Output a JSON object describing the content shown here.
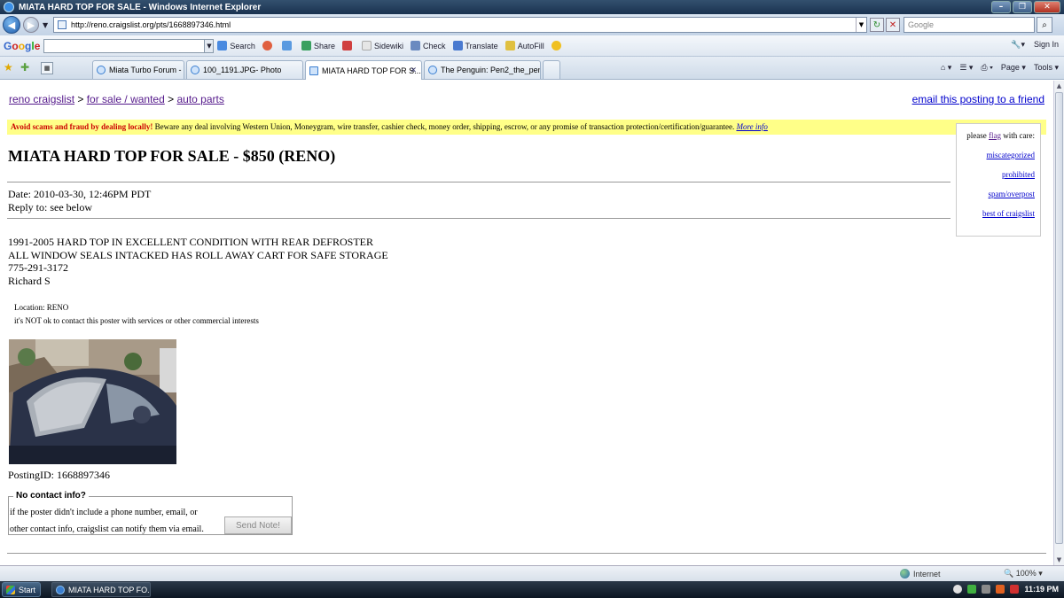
{
  "window": {
    "title": "MIATA HARD TOP FOR SALE - Windows Internet Explorer",
    "minimize": "–",
    "maximize": "❐",
    "close": "✕"
  },
  "address_bar": {
    "url": "http://reno.craigslist.org/pts/1668897346.html",
    "search_placeholder": "Google"
  },
  "google_toolbar": {
    "search_label": "Search",
    "share_label": "Share",
    "sidewiki_label": "Sidewiki",
    "check_label": "Check",
    "translate_label": "Translate",
    "autofill_label": "AutoFill",
    "sign_in_label": "Sign In"
  },
  "tabs": [
    {
      "label": "Miata Turbo Forum - Home ..."
    },
    {
      "label": "100_1191.JPG- Photo"
    },
    {
      "label": "MIATA HARD TOP FOR S..."
    },
    {
      "label": "The Penguin: Pen2_the_pen..."
    }
  ],
  "command_bar": {
    "page_label": "Page",
    "tools_label": "Tools"
  },
  "page": {
    "breadcrumb": {
      "site": "reno craigslist",
      "sep1": " > ",
      "category": "for sale / wanted",
      "sep2": " > ",
      "subcategory": "auto parts"
    },
    "email_friend": "email this posting to a friend",
    "warning": {
      "bold": "Avoid scams and fraud by dealing locally!",
      "text": " Beware any deal involving Western Union, Moneygram, wire transfer, cashier check, money order, shipping, escrow, or any promise of transaction protection/certification/guarantee. ",
      "more": "More info"
    },
    "title": "MIATA HARD TOP FOR SALE - $850 (RENO)",
    "date": "Date: 2010-03-30, 12:46PM PDT",
    "reply_to": "Reply to: see below",
    "body": [
      "1991-2005 HARD TOP IN EXCELLENT CONDITION WITH REAR DEFROSTER",
      "ALL WINDOW SEALS INTACKED HAS ROLL AWAY CART FOR SAFE STORAGE",
      "775-291-3172",
      "Richard S"
    ],
    "location": "Location: RENO",
    "commercial_notice": "it's NOT ok to contact this poster with services or other commercial interests",
    "posting_id": "PostingID: 1668897346",
    "contact": {
      "legend": "No contact info?",
      "line1": "if the poster didn't include a phone number, email, or",
      "line2": "other contact info, craigslist can notify them via email.",
      "button": "Send Note!"
    },
    "flag": {
      "lead_pre": "please ",
      "lead_link": "flag",
      "lead_post": " with care:",
      "items": [
        "miscategorized",
        "prohibited",
        "spam/overpost",
        "best of craigslist"
      ]
    }
  },
  "status_bar": {
    "zone": "Internet",
    "zoom": "100%"
  },
  "taskbar": {
    "start": "Start",
    "item": "MIATA HARD TOP FO...",
    "time": "11:19 PM"
  }
}
